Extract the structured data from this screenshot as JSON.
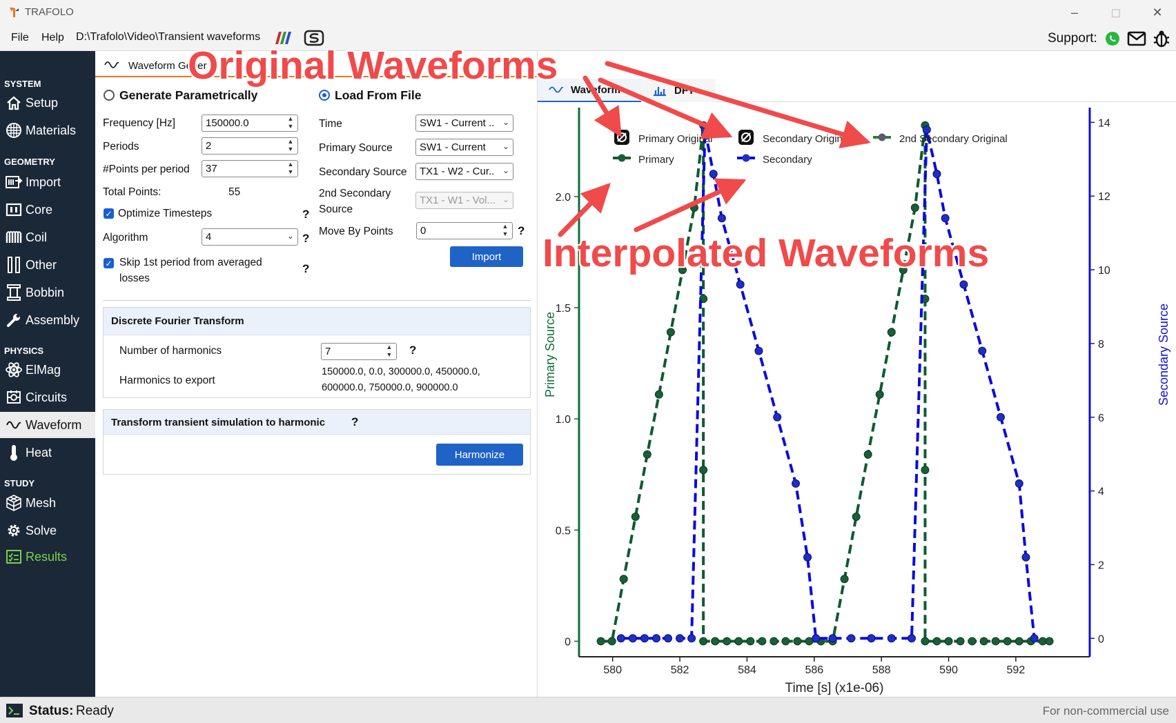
{
  "window": {
    "title": "TRAFOLO",
    "minimize_icon": "minimize-icon",
    "maximize_icon": "maximize-icon",
    "close_icon": "close-icon"
  },
  "menu": {
    "file": "File",
    "help": "Help",
    "path": "D:\\Trafolo\\Video\\Transient waveforms",
    "support": "Support:"
  },
  "sidebar": {
    "sections": {
      "system": "SYSTEM",
      "geometry": "GEOMETRY",
      "physics": "PHYSICS",
      "study": "STUDY"
    },
    "items": {
      "setup": "Setup",
      "materials": "Materials",
      "import": "Import",
      "core": "Core",
      "coil": "Coil",
      "other": "Other",
      "bobbin": "Bobbin",
      "assembly": "Assembly",
      "elmag": "ElMag",
      "circuits": "Circuits",
      "waveform": "Waveform",
      "heat": "Heat",
      "mesh": "Mesh",
      "solve": "Solve",
      "results": "Results"
    },
    "active": "Waveform"
  },
  "panel": {
    "tab": "Waveform Gener",
    "generate_param": "Generate Parametrically",
    "load_from_file": "Load From File",
    "selected_mode": "Load From File",
    "frequency_label": "Frequency [Hz]",
    "frequency_value": "150000.0",
    "periods_label": "Periods",
    "periods_value": "2",
    "points_label": "#Points per period",
    "points_value": "37",
    "total_points_label": "Total Points:",
    "total_points_value": "55",
    "optimize_label": "Optimize Timesteps",
    "optimize_checked": true,
    "algorithm_label": "Algorithm",
    "algorithm_value": "4",
    "skip_label_line1": "Skip 1st period from averaged",
    "skip_label_line2": "losses",
    "skip_checked": true,
    "time_label": "Time",
    "time_value": "SW1 - Current ..",
    "primary_label": "Primary Source",
    "primary_value": "SW1 - Current",
    "secondary_label": "Secondary Source",
    "secondary_value": "TX1 - W2 - Cur..",
    "second_secondary_label_line1": "2nd Secondary",
    "second_secondary_label_line2": "Source",
    "second_secondary_value": "TX1 - W1 - Vol...",
    "move_label": "Move By Points",
    "move_value": "0",
    "import_button": "Import",
    "help_mark": "?",
    "dft": {
      "title": "Discrete Fourier Transform",
      "harmonics_label": "Number of harmonics",
      "harmonics_value": "7",
      "export_label": "Harmonics to export",
      "export_line1": "150000.0, 0.0, 300000.0, 450000.0,",
      "export_line2": "600000.0, 750000.0, 900000.0"
    },
    "transform": {
      "title": "Transform transient simulation to harmonic",
      "button": "Harmonize"
    }
  },
  "chart_tabs": {
    "waveform": "Waveform",
    "dft": "DFT"
  },
  "chart_data": {
    "type": "line",
    "xlabel": "Time [s] (x1e-06)",
    "ylabel_left": "Primary Source",
    "ylabel_right": "Secondary Source",
    "xlim": [
      579.0,
      594.2
    ],
    "ylim_left": [
      -0.07,
      2.4
    ],
    "ylim_right": [
      -0.5,
      14.4
    ],
    "x_ticks": [
      580,
      582,
      584,
      586,
      588,
      590,
      592
    ],
    "y_left_ticks": [
      0,
      0.5,
      1.0,
      1.5,
      2.0
    ],
    "y_left_tick_labels": [
      "0",
      "0.5",
      "1.0",
      "1.5",
      "2.0"
    ],
    "y_right_ticks": [
      0,
      2,
      4,
      6,
      8,
      10,
      12,
      14
    ],
    "legend": {
      "primary_original": "Primary Original",
      "secondary_original": "Secondary Original",
      "second_secondary_original": "2nd Secondary Original",
      "primary": "Primary",
      "secondary": "Secondary"
    },
    "colors": {
      "primary": "#0f5a32",
      "primary_marker": "#1a5e3a",
      "secondary": "#0a0ae0",
      "secondary_marker": "#1d2fc4",
      "axis_left": "#0f6b3c",
      "axis_right": "#1010d8"
    },
    "primary_points": [
      [
        579.65,
        0
      ],
      [
        579.98,
        0
      ],
      [
        580.33,
        0.28
      ],
      [
        580.68,
        0.56
      ],
      [
        581.03,
        0.84
      ],
      [
        581.38,
        1.11
      ],
      [
        581.73,
        1.39
      ],
      [
        582.08,
        1.67
      ],
      [
        582.43,
        1.95
      ],
      [
        582.7,
        2.32
      ],
      [
        582.7,
        1.54
      ],
      [
        582.7,
        0.77
      ],
      [
        582.7,
        0
      ],
      [
        583.05,
        0
      ],
      [
        583.4,
        0
      ],
      [
        583.75,
        0
      ],
      [
        584.1,
        0
      ],
      [
        584.45,
        0
      ],
      [
        584.8,
        0
      ],
      [
        585.15,
        0
      ],
      [
        585.5,
        0
      ],
      [
        585.85,
        0
      ],
      [
        586.2,
        0
      ],
      [
        586.55,
        0
      ],
      [
        586.9,
        0.28
      ],
      [
        587.25,
        0.56
      ],
      [
        587.6,
        0.84
      ],
      [
        587.95,
        1.11
      ],
      [
        588.3,
        1.39
      ],
      [
        588.65,
        1.67
      ],
      [
        589.0,
        1.95
      ],
      [
        589.3,
        2.32
      ],
      [
        589.3,
        1.54
      ],
      [
        589.3,
        0.77
      ],
      [
        589.3,
        0
      ],
      [
        589.65,
        0
      ],
      [
        590.0,
        0
      ],
      [
        590.35,
        0
      ],
      [
        590.7,
        0
      ],
      [
        591.05,
        0
      ],
      [
        591.4,
        0
      ],
      [
        591.75,
        0
      ],
      [
        592.1,
        0
      ],
      [
        592.45,
        0
      ],
      [
        592.8,
        0
      ],
      [
        593.0,
        0
      ]
    ],
    "secondary_points": [
      [
        580.25,
        0
      ],
      [
        580.6,
        0
      ],
      [
        580.95,
        0
      ],
      [
        581.3,
        0
      ],
      [
        581.65,
        0
      ],
      [
        582.0,
        0
      ],
      [
        582.35,
        0
      ],
      [
        582.75,
        13.8
      ],
      [
        583.0,
        12.6
      ],
      [
        583.25,
        11.4
      ],
      [
        583.8,
        9.6
      ],
      [
        584.35,
        7.8
      ],
      [
        584.9,
        6.0
      ],
      [
        585.45,
        4.2
      ],
      [
        585.8,
        2.2
      ],
      [
        586.05,
        0
      ],
      [
        586.55,
        0
      ],
      [
        587.1,
        0
      ],
      [
        587.7,
        0
      ],
      [
        588.3,
        0
      ],
      [
        588.9,
        0
      ],
      [
        589.35,
        13.8
      ],
      [
        589.65,
        12.6
      ],
      [
        589.9,
        11.4
      ],
      [
        590.45,
        9.6
      ],
      [
        591.0,
        7.8
      ],
      [
        591.55,
        6.0
      ],
      [
        592.1,
        4.2
      ],
      [
        592.3,
        2.2
      ],
      [
        592.55,
        0
      ]
    ]
  },
  "annotations": {
    "original": "Original Waveforms",
    "interpolated": "Interpolated Waveforms"
  },
  "status": {
    "label": "Status:",
    "value": "Ready",
    "note": "For non-commercial use"
  }
}
